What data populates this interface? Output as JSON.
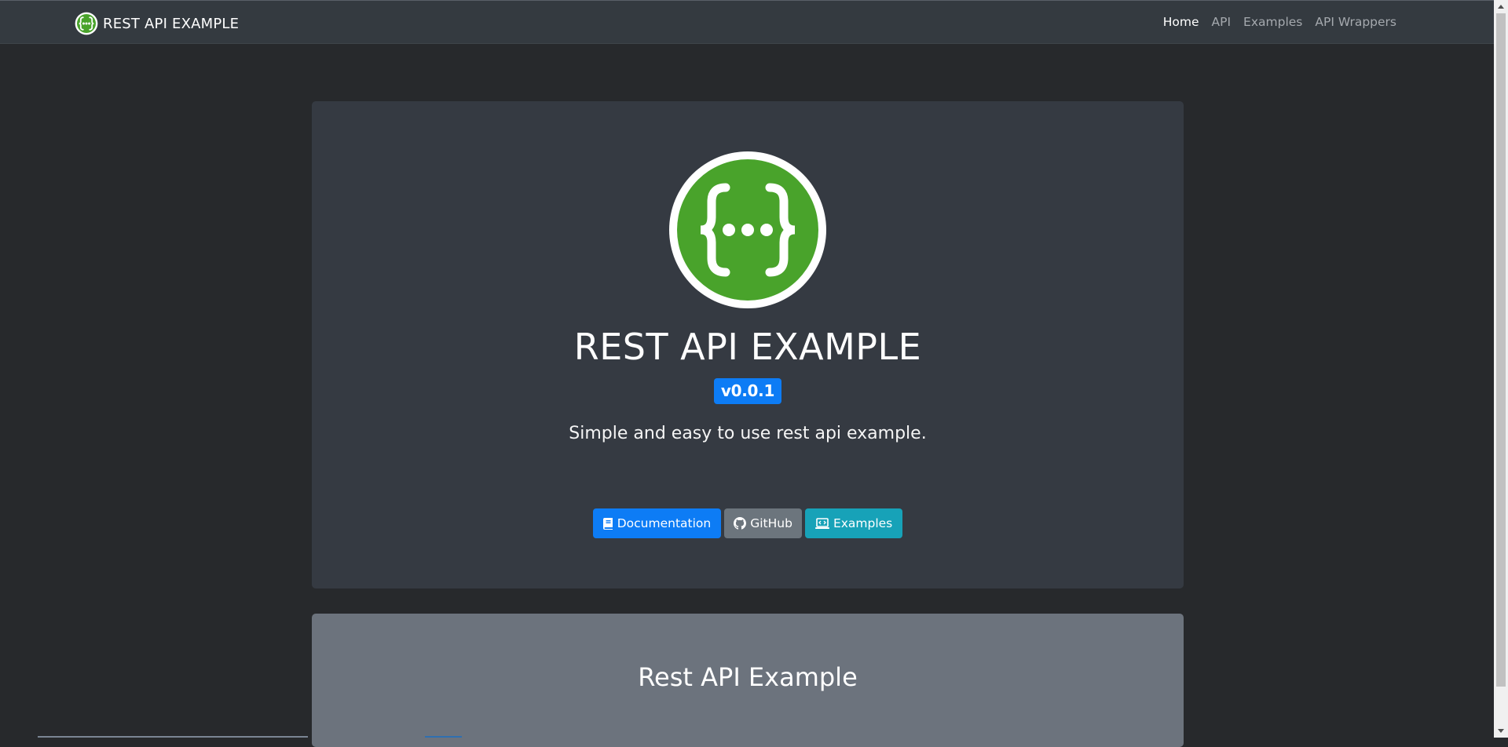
{
  "navbar": {
    "brand_label": "REST API EXAMPLE",
    "brand_icon": "swagger-logo-icon",
    "links": [
      {
        "label": "Home",
        "active": true
      },
      {
        "label": "API",
        "active": false
      },
      {
        "label": "Examples",
        "active": false
      },
      {
        "label": "API Wrappers",
        "active": false
      }
    ]
  },
  "hero": {
    "logo_icon": "swagger-logo-icon",
    "title": "REST API EXAMPLE",
    "version": "v0.0.1",
    "tagline": "Simple and easy to use rest api example.",
    "buttons": [
      {
        "label": "Documentation",
        "icon": "book-icon",
        "color": "#0d7cf5"
      },
      {
        "label": "GitHub",
        "icon": "github-icon",
        "color": "#6c757d"
      },
      {
        "label": "Examples",
        "icon": "laptop-code-icon",
        "color": "#17a2b8"
      }
    ]
  },
  "section": {
    "title": "Rest API Example"
  },
  "colors": {
    "background": "#27292c",
    "navbar": "#343a40",
    "jumbotron": "#353a42",
    "card": "#6c737d",
    "logo_green": "#49a32b",
    "primary": "#0d7cf5"
  }
}
